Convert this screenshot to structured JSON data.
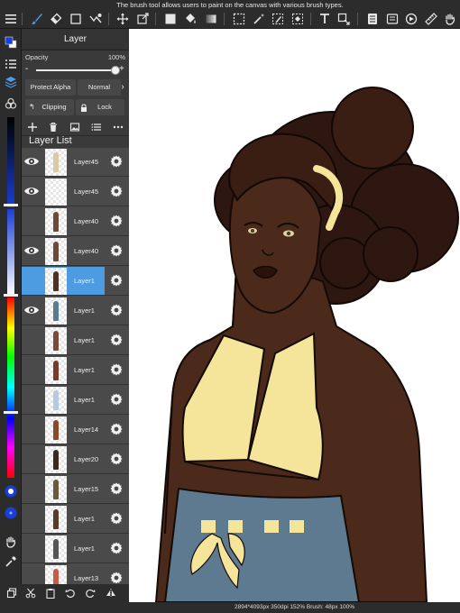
{
  "tooltip": "The brush tool allows users to paint on the canvas with various brush types.",
  "panel": {
    "title": "Layer",
    "opacity_label": "Opacity",
    "opacity_value": "100%",
    "opacity_fraction": 1.0,
    "opacity_minus": "-",
    "opacity_plus": "+",
    "protect_alpha": "Protect Alpha",
    "blend_mode": "Normal",
    "blend_arrow": "›",
    "clipping": "Clipping",
    "lock": "Lock",
    "layer_list_title": "Layer List"
  },
  "layers": [
    {
      "name": "Layer45",
      "visible": true,
      "selected": false,
      "figure": "#d9c9a8"
    },
    {
      "name": "Layer45",
      "visible": true,
      "selected": false,
      "figure": ""
    },
    {
      "name": "Layer40",
      "visible": false,
      "selected": false,
      "figure": "#6b4a3a"
    },
    {
      "name": "Layer40",
      "visible": true,
      "selected": false,
      "figure": "#6b4a3a"
    },
    {
      "name": "Layer1",
      "visible": false,
      "selected": true,
      "figure": "#4b3224"
    },
    {
      "name": "Layer1",
      "visible": true,
      "selected": false,
      "figure": "#5a7a8e"
    },
    {
      "name": "Layer1",
      "visible": false,
      "selected": false,
      "figure": "#7a4a3a"
    },
    {
      "name": "Layer1",
      "visible": false,
      "selected": false,
      "figure": "#7a3a2a"
    },
    {
      "name": "Layer1",
      "visible": false,
      "selected": false,
      "figure": "#b8c8e0"
    },
    {
      "name": "Layer14",
      "visible": false,
      "selected": false,
      "figure": "#8a4a2a"
    },
    {
      "name": "Layer20",
      "visible": false,
      "selected": false,
      "figure": "#3a2a22"
    },
    {
      "name": "Layer15",
      "visible": false,
      "selected": false,
      "figure": "#6a5a3a"
    },
    {
      "name": "Layer1",
      "visible": false,
      "selected": false,
      "figure": "#5a3a2a"
    },
    {
      "name": "Layer1",
      "visible": false,
      "selected": false,
      "figure": "#555555"
    },
    {
      "name": "Layer13",
      "visible": false,
      "selected": false,
      "figure": "#c85a4a"
    }
  ],
  "status": "2894*4093px 350dpi 152% Brush: 48px 100%",
  "colors": {
    "toolbar_bg": "#2c2c2c",
    "accent": "#4d9be0",
    "primary_color": "#1a3fd6",
    "secondary_color": "#ffffff",
    "skin": "#4b2a1c",
    "hair": "#2e1710",
    "top": "#f5e59a",
    "skirt": "#5d7a90"
  }
}
